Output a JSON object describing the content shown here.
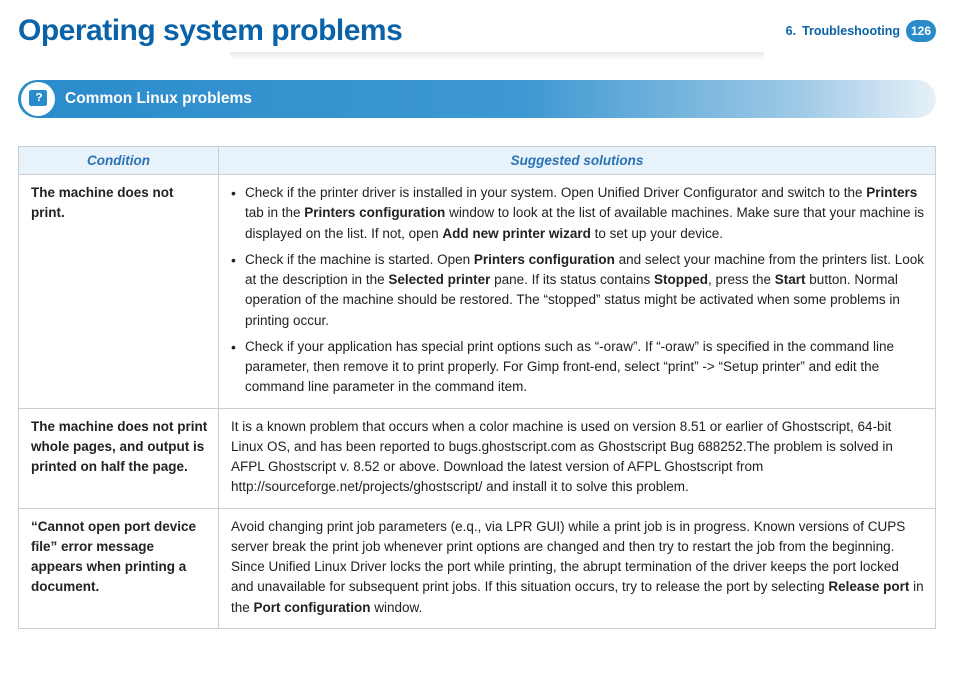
{
  "header": {
    "title": "Operating system problems",
    "crumb_num": "6.",
    "crumb_text": "Troubleshooting",
    "page": "126"
  },
  "section": {
    "title": "Common Linux problems"
  },
  "table": {
    "col_condition": "Condition",
    "col_solutions": "Suggested solutions",
    "rows": [
      {
        "condition": "The machine does not print.",
        "sol1_pre": "Check if the printer driver is installed in your system. Open Unified Driver Configurator and switch to the ",
        "sol1_b1": "Printers",
        "sol1_mid1": " tab in the ",
        "sol1_b2": "Printers configuration",
        "sol1_mid2": " window to look at the list of available machines. Make sure that your machine is displayed on the list. If not, open ",
        "sol1_b3": "Add new printer wizard",
        "sol1_post": " to set up your device.",
        "sol2_pre": "Check if the machine is started. Open ",
        "sol2_b1": "Printers configuration",
        "sol2_mid1": " and select your machine from the printers list. Look at the description in the ",
        "sol2_b2": "Selected printer",
        "sol2_mid2": " pane. If its status contains ",
        "sol2_b3": "Stopped",
        "sol2_mid3": ", press the ",
        "sol2_b4": "Start",
        "sol2_post": " button. Normal operation of the machine should be restored. The “stopped” status might be activated when some problems in printing occur.",
        "sol3": "Check if your application has special print options such as “-oraw”. If “-oraw” is specified in the command line parameter, then remove it to print properly. For Gimp front-end, select “print” -> “Setup printer” and edit the command line parameter in the command item."
      },
      {
        "condition": "The machine does not print whole pages, and output is printed on half the page.",
        "solution": "It is a known problem that occurs when a color machine is used on version 8.51 or earlier of Ghostscript, 64-bit Linux OS, and has been reported to bugs.ghostscript.com as Ghostscript Bug 688252.The problem is solved in AFPL Ghostscript v. 8.52 or above. Download the latest version of AFPL Ghostscript from http://sourceforge.net/projects/ghostscript/ and install it to solve this problem."
      },
      {
        "condition": "“Cannot open port device file” error message appears when printing a document.",
        "sol_pre": "Avoid changing print job parameters (e.q., via LPR GUI) while a print job is in progress. Known versions of CUPS server break the print job whenever print options are changed and then try to restart the job from the beginning. Since Unified Linux Driver locks the port while printing, the abrupt termination of the driver keeps the port locked and unavailable for subsequent print jobs. If this situation occurs, try to release the port by selecting ",
        "sol_b1": "Release port",
        "sol_mid": " in the ",
        "sol_b2": "Port configuration",
        "sol_post": " window."
      }
    ]
  }
}
